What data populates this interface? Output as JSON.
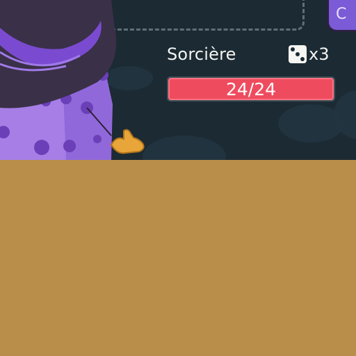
{
  "enemy": {
    "name": "Sorcière",
    "hp_text": "24/24",
    "hp_fraction": 1.0,
    "dice_count_label": "x3",
    "die_face": 3
  },
  "corner_button": {
    "label": "C"
  },
  "colors": {
    "background": "#1c2a33",
    "hp_bar": "#ef4b5f",
    "hat_purple": "#7b4fd1",
    "panel": "#b98d4a"
  },
  "icons": [
    "witch-character",
    "die-icon",
    "hand-pointer-icon"
  ]
}
